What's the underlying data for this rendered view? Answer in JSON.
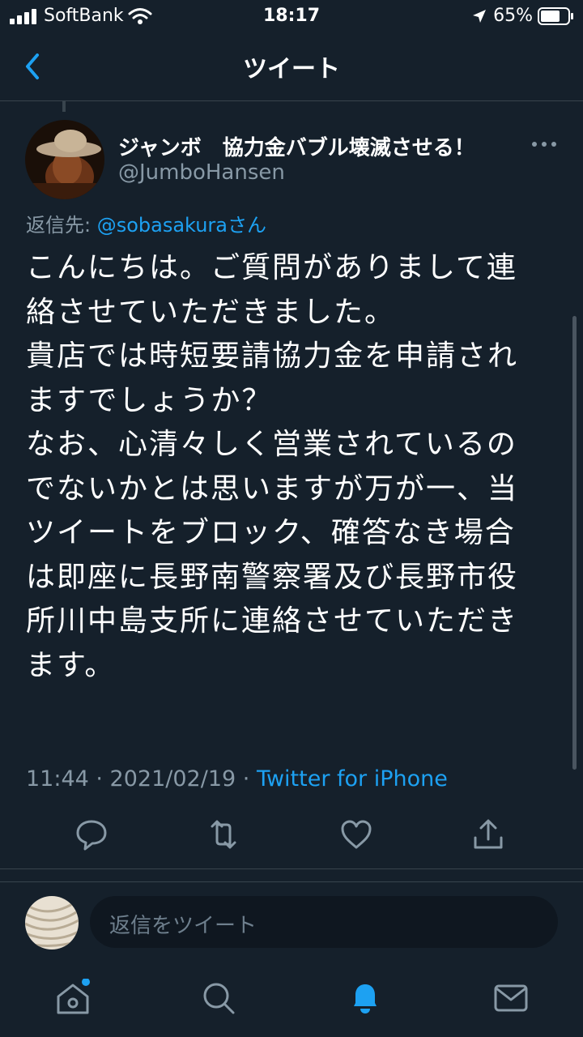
{
  "status_bar": {
    "carrier": "SoftBank",
    "time": "18:17",
    "battery": "65%"
  },
  "nav": {
    "title": "ツイート"
  },
  "tweet": {
    "display_name": "ジャンボ　協力金バブル壊滅させる！",
    "handle": "@JumboHansen",
    "reply_prefix": "返信先: ",
    "reply_target": "@sobasakuraさん",
    "body_lines": [
      "こんにちは。ご質問がありまして連",
      "絡させていただきました。",
      "貴店では時短要請協力金を申請され",
      "ますでしょうか？",
      "なお、心清々しく営業されているの",
      "でないかとは思いますが万が一、当",
      "ツイートをブロック、確答なき場合",
      "は即座に長野南警察署及び長野市役",
      "所川中島支所に連絡させていただき",
      "ます。"
    ],
    "timestamp": "11:44 · 2021/02/19 · ",
    "source": "Twitter for iPhone"
  },
  "reply": {
    "placeholder": "返信をツイート"
  },
  "colors": {
    "background": "#15202b",
    "accent": "#1da1f2",
    "secondary_text": "#8899a6",
    "divider": "#38444d"
  },
  "icons": {
    "actions": [
      "reply-icon",
      "retweet-icon",
      "like-icon",
      "share-icon"
    ],
    "tabs": [
      "home-icon",
      "search-icon",
      "notifications-icon",
      "messages-icon"
    ]
  }
}
